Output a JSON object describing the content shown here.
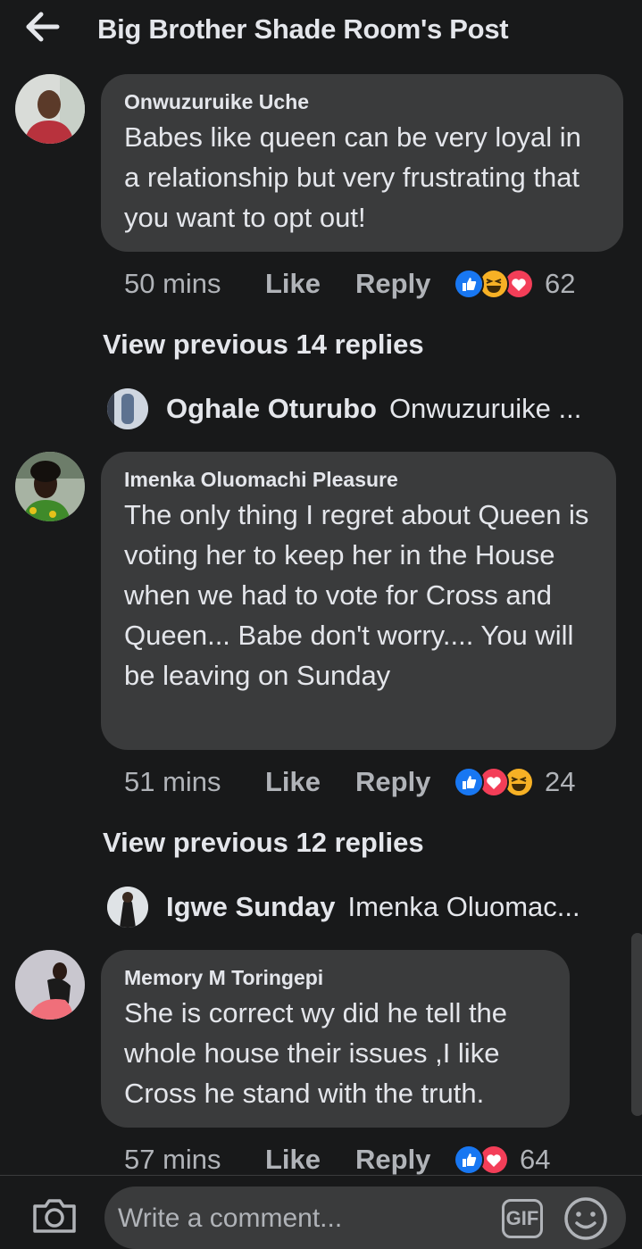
{
  "header": {
    "title": "Big Brother Shade Room's Post"
  },
  "comments": [
    {
      "author": "Onwuzuruike Uche",
      "text": "Babes like queen can be very loyal in a relationship but very frustrating that you want to opt out!",
      "time": "50 mins",
      "like_label": "Like",
      "reply_label": "Reply",
      "reactions": [
        "like",
        "haha",
        "love"
      ],
      "reaction_count": "62",
      "view_previous": "View previous 14 replies",
      "latest_reply": {
        "author": "Oghale Oturubo",
        "text": "Onwuzuruike ..."
      }
    },
    {
      "author": "Imenka Oluomachi Pleasure",
      "text": "The only thing I regret about Queen is voting her to keep her in the House when we had to vote for Cross and Queen... Babe don't worry.... You will be leaving on Sunday",
      "time": "51 mins",
      "like_label": "Like",
      "reply_label": "Reply",
      "reactions": [
        "like",
        "love",
        "haha"
      ],
      "reaction_count": "24",
      "view_previous": "View previous 12 replies",
      "latest_reply": {
        "author": "Igwe Sunday",
        "text": "Imenka Oluomac..."
      }
    },
    {
      "author": "Memory M Toringepi",
      "text": "She is correct  wy did he tell the whole house their issues ,I like Cross  he stand with the truth.",
      "time": "57 mins",
      "like_label": "Like",
      "reply_label": "Reply",
      "reactions": [
        "like",
        "love"
      ],
      "reaction_count": "64"
    }
  ],
  "composer": {
    "placeholder": "Write a comment...",
    "gif_label": "GIF"
  },
  "colors": {
    "background": "#18191a",
    "bubble": "#3a3b3c",
    "text": "#e4e6eb",
    "secondary_text": "#b0b3b8",
    "like_blue": "#1877f2",
    "love_red": "#f33e58",
    "haha_yellow": "#f7b125"
  }
}
